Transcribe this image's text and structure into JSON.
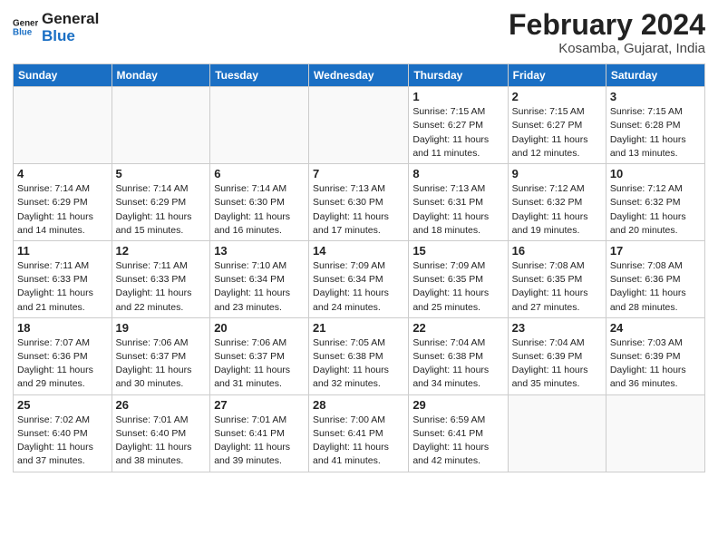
{
  "header": {
    "logo_line1": "General",
    "logo_line2": "Blue",
    "month_title": "February 2024",
    "subtitle": "Kosamba, Gujarat, India"
  },
  "weekdays": [
    "Sunday",
    "Monday",
    "Tuesday",
    "Wednesday",
    "Thursday",
    "Friday",
    "Saturday"
  ],
  "weeks": [
    [
      {
        "day": "",
        "info": ""
      },
      {
        "day": "",
        "info": ""
      },
      {
        "day": "",
        "info": ""
      },
      {
        "day": "",
        "info": ""
      },
      {
        "day": "1",
        "info": "Sunrise: 7:15 AM\nSunset: 6:27 PM\nDaylight: 11 hours\nand 11 minutes."
      },
      {
        "day": "2",
        "info": "Sunrise: 7:15 AM\nSunset: 6:27 PM\nDaylight: 11 hours\nand 12 minutes."
      },
      {
        "day": "3",
        "info": "Sunrise: 7:15 AM\nSunset: 6:28 PM\nDaylight: 11 hours\nand 13 minutes."
      }
    ],
    [
      {
        "day": "4",
        "info": "Sunrise: 7:14 AM\nSunset: 6:29 PM\nDaylight: 11 hours\nand 14 minutes."
      },
      {
        "day": "5",
        "info": "Sunrise: 7:14 AM\nSunset: 6:29 PM\nDaylight: 11 hours\nand 15 minutes."
      },
      {
        "day": "6",
        "info": "Sunrise: 7:14 AM\nSunset: 6:30 PM\nDaylight: 11 hours\nand 16 minutes."
      },
      {
        "day": "7",
        "info": "Sunrise: 7:13 AM\nSunset: 6:30 PM\nDaylight: 11 hours\nand 17 minutes."
      },
      {
        "day": "8",
        "info": "Sunrise: 7:13 AM\nSunset: 6:31 PM\nDaylight: 11 hours\nand 18 minutes."
      },
      {
        "day": "9",
        "info": "Sunrise: 7:12 AM\nSunset: 6:32 PM\nDaylight: 11 hours\nand 19 minutes."
      },
      {
        "day": "10",
        "info": "Sunrise: 7:12 AM\nSunset: 6:32 PM\nDaylight: 11 hours\nand 20 minutes."
      }
    ],
    [
      {
        "day": "11",
        "info": "Sunrise: 7:11 AM\nSunset: 6:33 PM\nDaylight: 11 hours\nand 21 minutes."
      },
      {
        "day": "12",
        "info": "Sunrise: 7:11 AM\nSunset: 6:33 PM\nDaylight: 11 hours\nand 22 minutes."
      },
      {
        "day": "13",
        "info": "Sunrise: 7:10 AM\nSunset: 6:34 PM\nDaylight: 11 hours\nand 23 minutes."
      },
      {
        "day": "14",
        "info": "Sunrise: 7:09 AM\nSunset: 6:34 PM\nDaylight: 11 hours\nand 24 minutes."
      },
      {
        "day": "15",
        "info": "Sunrise: 7:09 AM\nSunset: 6:35 PM\nDaylight: 11 hours\nand 25 minutes."
      },
      {
        "day": "16",
        "info": "Sunrise: 7:08 AM\nSunset: 6:35 PM\nDaylight: 11 hours\nand 27 minutes."
      },
      {
        "day": "17",
        "info": "Sunrise: 7:08 AM\nSunset: 6:36 PM\nDaylight: 11 hours\nand 28 minutes."
      }
    ],
    [
      {
        "day": "18",
        "info": "Sunrise: 7:07 AM\nSunset: 6:36 PM\nDaylight: 11 hours\nand 29 minutes."
      },
      {
        "day": "19",
        "info": "Sunrise: 7:06 AM\nSunset: 6:37 PM\nDaylight: 11 hours\nand 30 minutes."
      },
      {
        "day": "20",
        "info": "Sunrise: 7:06 AM\nSunset: 6:37 PM\nDaylight: 11 hours\nand 31 minutes."
      },
      {
        "day": "21",
        "info": "Sunrise: 7:05 AM\nSunset: 6:38 PM\nDaylight: 11 hours\nand 32 minutes."
      },
      {
        "day": "22",
        "info": "Sunrise: 7:04 AM\nSunset: 6:38 PM\nDaylight: 11 hours\nand 34 minutes."
      },
      {
        "day": "23",
        "info": "Sunrise: 7:04 AM\nSunset: 6:39 PM\nDaylight: 11 hours\nand 35 minutes."
      },
      {
        "day": "24",
        "info": "Sunrise: 7:03 AM\nSunset: 6:39 PM\nDaylight: 11 hours\nand 36 minutes."
      }
    ],
    [
      {
        "day": "25",
        "info": "Sunrise: 7:02 AM\nSunset: 6:40 PM\nDaylight: 11 hours\nand 37 minutes."
      },
      {
        "day": "26",
        "info": "Sunrise: 7:01 AM\nSunset: 6:40 PM\nDaylight: 11 hours\nand 38 minutes."
      },
      {
        "day": "27",
        "info": "Sunrise: 7:01 AM\nSunset: 6:41 PM\nDaylight: 11 hours\nand 39 minutes."
      },
      {
        "day": "28",
        "info": "Sunrise: 7:00 AM\nSunset: 6:41 PM\nDaylight: 11 hours\nand 41 minutes."
      },
      {
        "day": "29",
        "info": "Sunrise: 6:59 AM\nSunset: 6:41 PM\nDaylight: 11 hours\nand 42 minutes."
      },
      {
        "day": "",
        "info": ""
      },
      {
        "day": "",
        "info": ""
      }
    ]
  ]
}
